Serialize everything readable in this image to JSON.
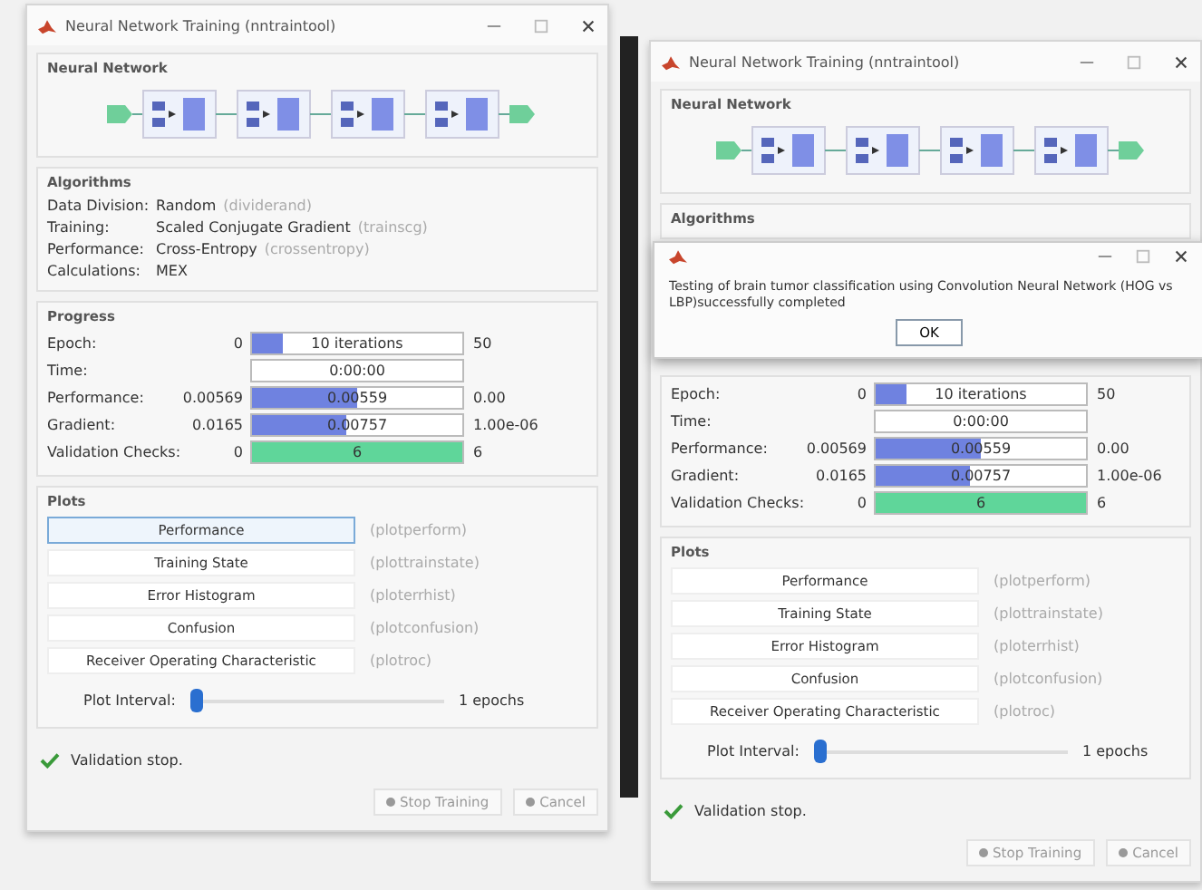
{
  "windows": [
    {
      "title": "Neural Network Training (nntraintool)",
      "network_heading": "Neural Network",
      "algorithms": {
        "heading": "Algorithms",
        "rows": [
          {
            "label": "Data Division:",
            "value": "Random",
            "fn": "(dividerand)"
          },
          {
            "label": "Training:",
            "value": "Scaled Conjugate Gradient",
            "fn": "(trainscg)"
          },
          {
            "label": "Performance:",
            "value": "Cross-Entropy",
            "fn": "(crossentropy)"
          },
          {
            "label": "Calculations:",
            "value": "MEX"
          }
        ]
      },
      "progress": {
        "heading": "Progress",
        "rows": [
          {
            "label": "Epoch:",
            "start": "0",
            "bar": "10 iterations",
            "level": 0.15,
            "color": "#6f82e0",
            "end": "50"
          },
          {
            "label": "Time:",
            "bar": "0:00:00"
          },
          {
            "label": "Performance:",
            "start": "0.00569",
            "bar": "0.00559",
            "level": 0.5,
            "color": "#6f82e0",
            "end": "0.00"
          },
          {
            "label": "Gradient:",
            "start": "0.0165",
            "bar": "0.00757",
            "level": 0.45,
            "color": "#6f82e0",
            "end": "1.00e-06"
          },
          {
            "label": "Validation Checks:",
            "start": "0",
            "bar": "6",
            "level": 1,
            "color": "#5fd69a",
            "end": "6"
          }
        ]
      },
      "plots": {
        "heading": "Plots",
        "buttons": [
          {
            "label": "Performance",
            "fn": "(plotperform)",
            "selected": true
          },
          {
            "label": "Training State",
            "fn": "(plottrainstate)",
            "selected": false
          },
          {
            "label": "Error Histogram",
            "fn": "(ploterrhist)",
            "selected": false
          },
          {
            "label": "Confusion",
            "fn": "(plotconfusion)",
            "selected": false
          },
          {
            "label": "Receiver Operating Characteristic",
            "fn": "(plotroc)",
            "selected": false
          }
        ],
        "interval": {
          "label": "Plot Interval:",
          "level": 0,
          "reading": "1 epochs"
        }
      },
      "status": "Validation stop.",
      "actions": [
        "Stop Training",
        "Cancel"
      ]
    },
    {
      "title": "Neural Network Training (nntraintool)",
      "network_heading": "Neural Network",
      "algorithms": {
        "heading": "Algorithms"
      },
      "dialog": {
        "message": "Testing of brain tumor classification using Convolution Neural Network (HOG vs LBP)successfully completed",
        "button": "OK"
      },
      "progress": {
        "rows": [
          {
            "label": "Epoch:",
            "start": "0",
            "bar": "10 iterations",
            "level": 0.15,
            "color": "#6f82e0",
            "end": "50"
          },
          {
            "label": "Time:",
            "bar": "0:00:00"
          },
          {
            "label": "Performance:",
            "start": "0.00569",
            "bar": "0.00559",
            "level": 0.5,
            "color": "#6f82e0",
            "end": "0.00"
          },
          {
            "label": "Gradient:",
            "start": "0.0165",
            "bar": "0.00757",
            "level": 0.45,
            "color": "#6f82e0",
            "end": "1.00e-06"
          },
          {
            "label": "Validation Checks:",
            "start": "0",
            "bar": "6",
            "level": 1,
            "color": "#5fd69a",
            "end": "6"
          }
        ]
      },
      "plots": {
        "heading": "Plots",
        "buttons": [
          {
            "label": "Performance",
            "fn": "(plotperform)",
            "selected": false
          },
          {
            "label": "Training State",
            "fn": "(plottrainstate)",
            "selected": false
          },
          {
            "label": "Error Histogram",
            "fn": "(ploterrhist)",
            "selected": false
          },
          {
            "label": "Confusion",
            "fn": "(plotconfusion)",
            "selected": false
          },
          {
            "label": "Receiver Operating Characteristic",
            "fn": "(plotroc)",
            "selected": false
          }
        ],
        "interval": {
          "label": "Plot Interval:",
          "level": 0,
          "reading": "1 epochs"
        }
      },
      "status": "Validation stop.",
      "actions": [
        "Stop Training",
        "Cancel"
      ]
    }
  ]
}
